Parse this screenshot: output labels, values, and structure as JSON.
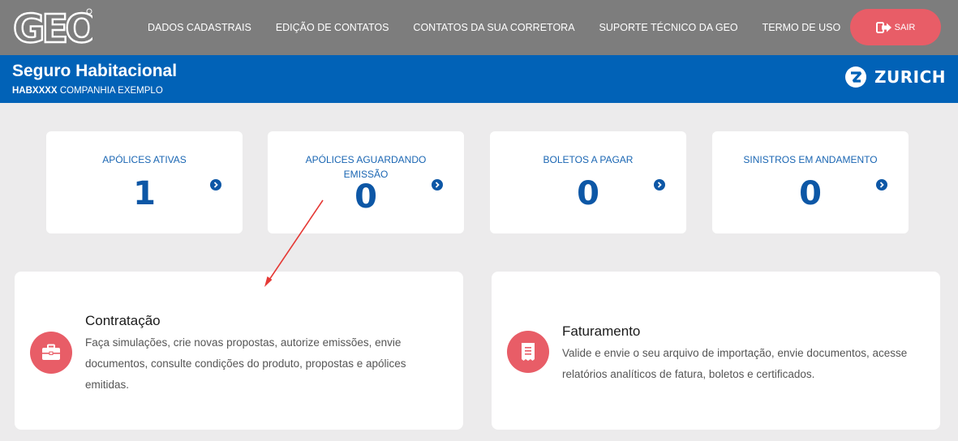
{
  "header": {
    "logo_text": "GEO",
    "nav": [
      "DADOS CADASTRAIS",
      "EDIÇÃO DE CONTATOS",
      "CONTATOS DA SUA CORRETORA",
      "SUPORTE TÉCNICO DA GEO",
      "TERMO DE USO"
    ],
    "logout_label": "SAIR"
  },
  "banner": {
    "title": "Seguro Habitacional",
    "policy_code": "HABXXXX",
    "company": "COMPANHIA EXEMPLO",
    "brand": "ZURICH"
  },
  "stats": [
    {
      "label": "APÓLICES ATIVAS",
      "value": "1"
    },
    {
      "label": "APÓLICES AGUARDANDO EMISSÃO",
      "value": "0"
    },
    {
      "label": "BOLETOS A PAGAR",
      "value": "0"
    },
    {
      "label": "SINISTROS EM ANDAMENTO",
      "value": "0"
    }
  ],
  "features": [
    {
      "title": "Contratação",
      "description": "Faça simulações, crie novas propostas, autorize emissões, envie documentos, consulte condições do produto, propostas e apólices emitidas.",
      "icon": "briefcase-icon"
    },
    {
      "title": "Faturamento",
      "description": "Valide e envie o seu arquivo de importação, envie documentos, acesse relatórios analíticos de fatura, boletos e certificados.",
      "icon": "document-icon"
    }
  ],
  "colors": {
    "topbar": "#7d7d7d",
    "banner": "#0162b7",
    "accent": "#e85d67",
    "stat_value": "#0d57a6",
    "annotation": "#e53935"
  }
}
